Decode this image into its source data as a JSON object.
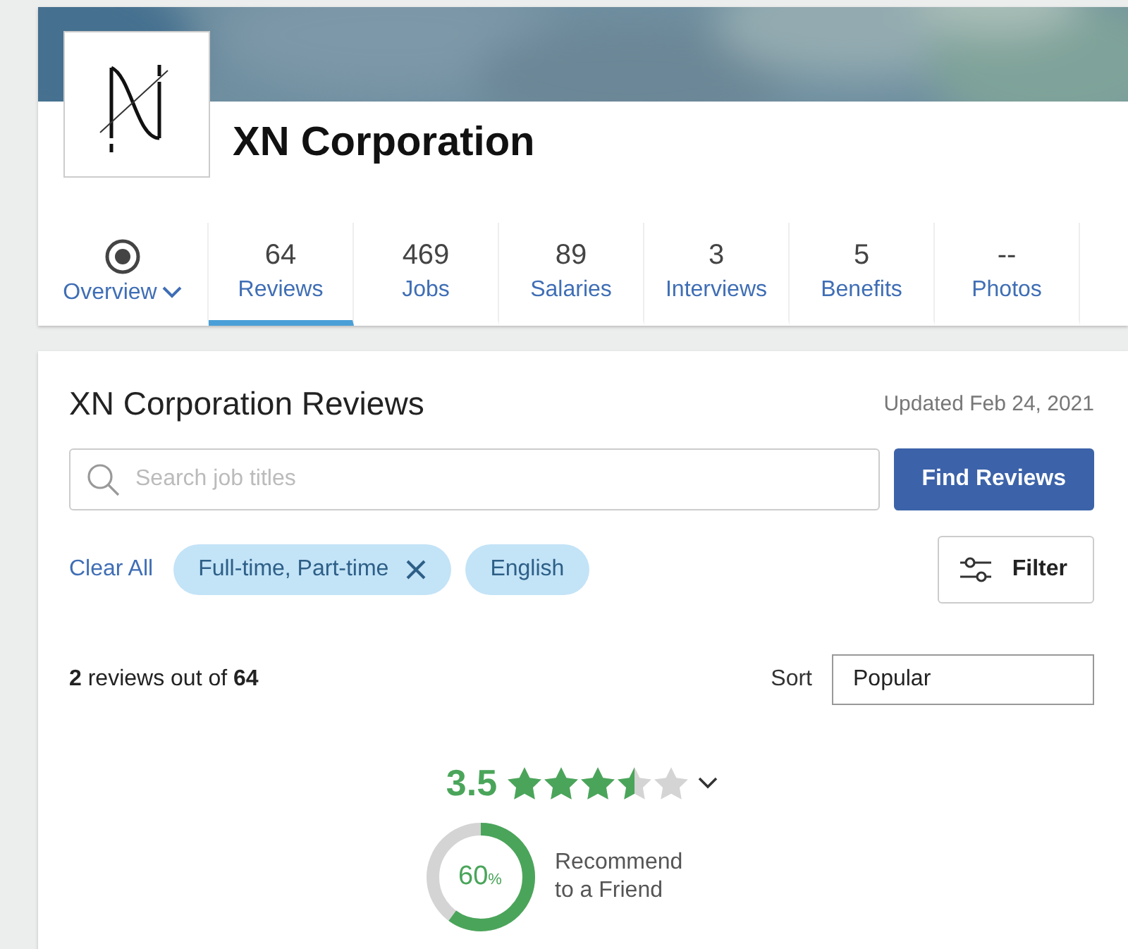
{
  "company": {
    "name": "XN Corporation"
  },
  "tabs": [
    {
      "label": "Overview",
      "kind": "overview",
      "selected": false
    },
    {
      "count": "64",
      "label": "Reviews",
      "kind": "count",
      "selected": true
    },
    {
      "count": "469",
      "label": "Jobs",
      "kind": "count",
      "selected": false
    },
    {
      "count": "89",
      "label": "Salaries",
      "kind": "count",
      "selected": false
    },
    {
      "count": "3",
      "label": "Interviews",
      "kind": "count",
      "selected": false
    },
    {
      "count": "5",
      "label": "Benefits",
      "kind": "count",
      "selected": false
    },
    {
      "count": "--",
      "label": "Photos",
      "kind": "count",
      "selected": false
    }
  ],
  "reviews": {
    "title": "XN Corporation Reviews",
    "updated": "Updated Feb 24, 2021",
    "search": {
      "placeholder": "Search job titles"
    },
    "find_button": "Find Reviews",
    "clear_all": "Clear All",
    "chips": [
      {
        "label": "Full-time, Part-time",
        "removable": true
      },
      {
        "label": "English",
        "removable": false
      }
    ],
    "filter_button": "Filter",
    "summary": "**2** reviews out of **64**",
    "sort_label": "Sort",
    "sort_value": "Popular",
    "rating": "3.5",
    "stars": 3.5,
    "recommend": {
      "value": "60",
      "unit": "%",
      "label": "Recommend to a Friend"
    }
  }
}
